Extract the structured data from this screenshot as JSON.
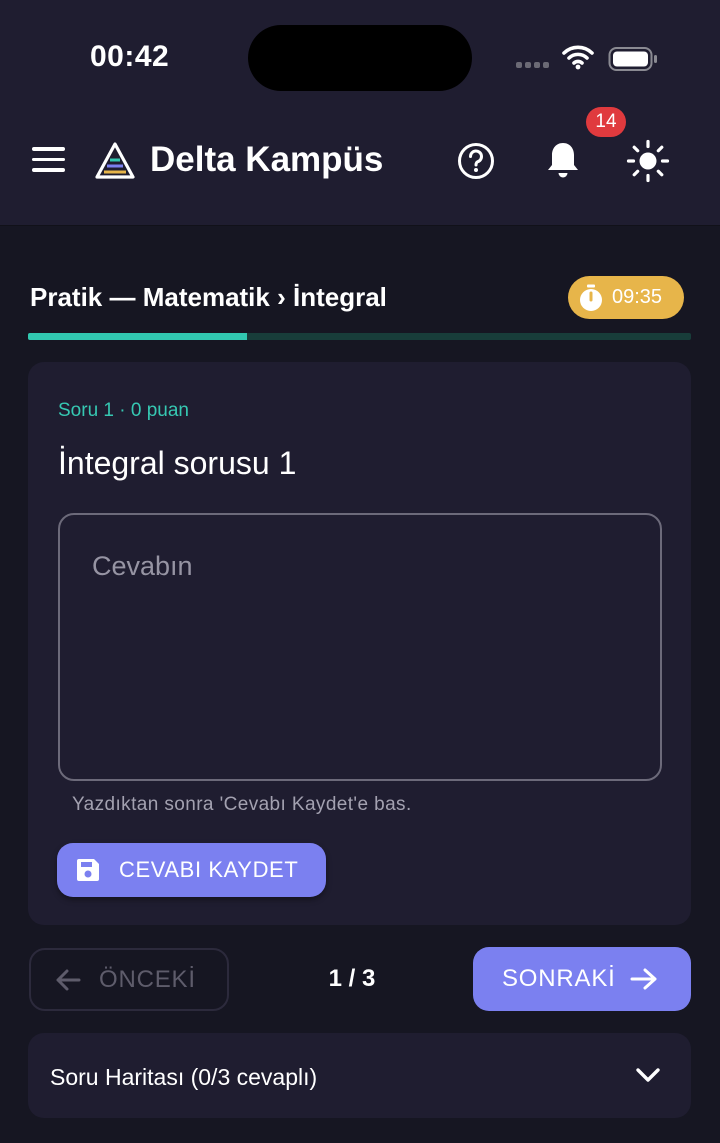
{
  "status_bar": {
    "time": "00:42"
  },
  "header": {
    "brand": "Delta Kampüs",
    "notification_count": "14"
  },
  "page": {
    "title": "Pratik — Matematik › İntegral",
    "timer": "09:35",
    "progress_fraction": 0.33
  },
  "question": {
    "meta": "Soru 1 · 0 puan",
    "title": "İntegral sorusu 1",
    "answer_value": "",
    "answer_placeholder": "Cevabın",
    "hint": "Yazdıktan sonra 'Cevabı Kaydet'e bas.",
    "save_label": "CEVABI KAYDET"
  },
  "navigation": {
    "prev_label": "ÖNCEKİ",
    "page_indicator": "1 / 3",
    "next_label": "SONRAKİ"
  },
  "question_map": {
    "label": "Soru Haritası (0/3 cevaplı)"
  },
  "colors": {
    "background": "#161622",
    "surface": "#1f1d30",
    "accent": "#7b80f0",
    "teal": "#31c8b0",
    "timer": "#e7b54a",
    "badge": "#e03a3e"
  },
  "icons": {
    "menu": "menu-icon",
    "logo": "delta-logo-icon",
    "help": "help-circle-icon",
    "bell": "bell-icon",
    "theme": "sun-icon",
    "timer": "stopwatch-icon",
    "save": "floppy-disk-icon",
    "prev": "arrow-left-icon",
    "next": "arrow-right-icon",
    "expand": "chevron-down-icon"
  }
}
